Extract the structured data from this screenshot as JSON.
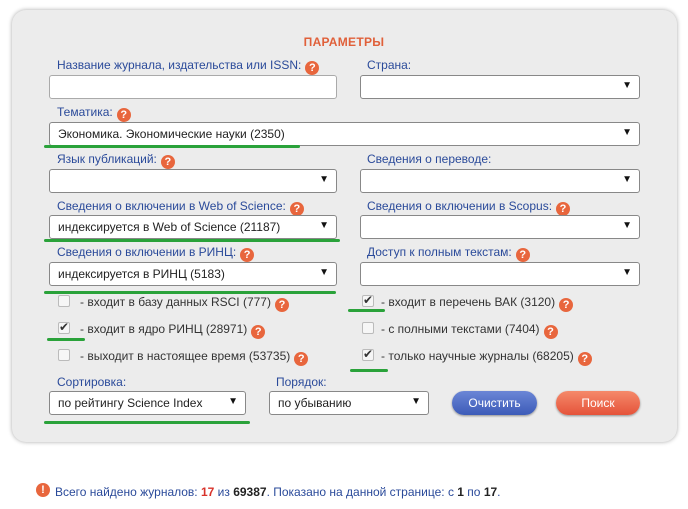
{
  "title": "ПАРАМЕТРЫ",
  "labels": {
    "journal": "Название журнала, издательства или ISSN:",
    "country": "Страна:",
    "topic": "Тематика:",
    "language": "Язык публикаций:",
    "translation": "Сведения о переводе:",
    "wos": "Сведения о включении в Web of Science:",
    "scopus": "Сведения о включении в Scopus:",
    "rinc": "Сведения о включении в РИНЦ:",
    "fulltext": "Доступ к полным текстам:",
    "sort": "Сортировка:",
    "order": "Порядок:"
  },
  "help_glyph": "?",
  "fields": {
    "journal": "",
    "country": "",
    "topic": "Экономика. Экономические науки  (2350)",
    "language": "",
    "translation": "",
    "wos": "индексируется в Web of Science  (21187)",
    "scopus": "",
    "rinc": "индексируется в РИНЦ  (5183)",
    "fulltext": "",
    "sort": "по рейтингу Science Index",
    "order": "по убыванию"
  },
  "checkboxes": [
    {
      "label": "- входит в базу данных RSCI (777)",
      "checked": false
    },
    {
      "label": "- входит в перечень ВАК (3120)",
      "checked": true
    },
    {
      "label": "- входит в ядро РИНЦ (28971)",
      "checked": true
    },
    {
      "label": "- с полными текстами (7404)",
      "checked": false
    },
    {
      "label": "- выходит в настоящее время (53735)",
      "checked": false
    },
    {
      "label": "- только научные журналы (68205)",
      "checked": true
    }
  ],
  "buttons": {
    "clear": "Очистить",
    "search": "Поиск"
  },
  "arrow_glyph": "▼",
  "check_glyph": "✔",
  "info_glyph": "!",
  "summary": {
    "text1": "Всего найдено журналов: ",
    "found": "17",
    "text2": " из ",
    "total": "69387",
    "text3": ".    Показано на данной странице: с ",
    "from": "1",
    "text4": " по ",
    "to": "17",
    "text5": "."
  },
  "colors": {
    "accent": "#e8663d",
    "label": "#2a4a9a",
    "highlight": "#2aa23a",
    "clear_btn": "#3c5bb8",
    "search_btn": "#e5533a"
  }
}
